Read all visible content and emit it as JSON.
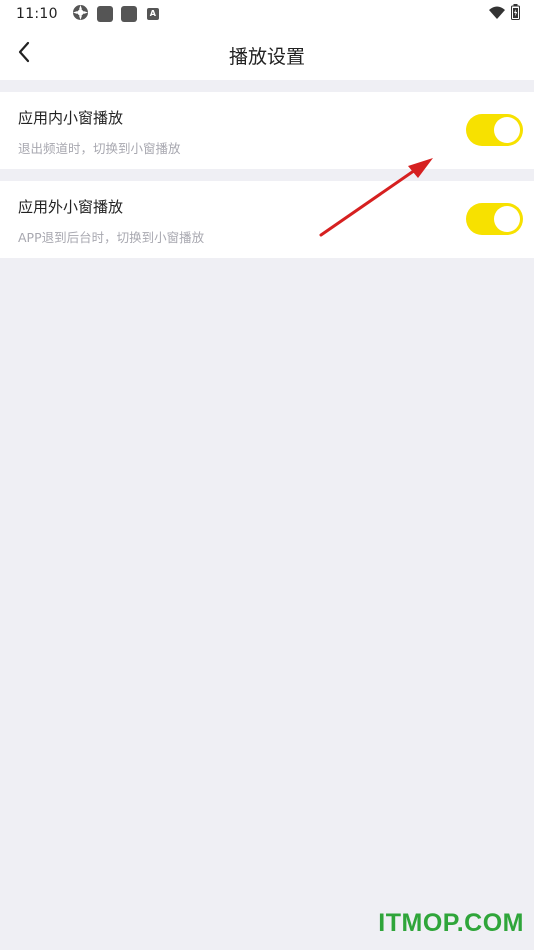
{
  "status_bar": {
    "time": "11:10",
    "icons": [
      "settings-icon",
      "app-icon",
      "app-icon",
      "a-icon",
      "wifi-icon",
      "battery-icon"
    ],
    "a_glyph": "A"
  },
  "nav": {
    "title": "播放设置",
    "back_icon": "chevron-left-icon"
  },
  "settings": [
    {
      "title": "应用内小窗播放",
      "subtitle": "退出频道时，切换到小窗播放",
      "enabled": true
    },
    {
      "title": "应用外小窗播放",
      "subtitle": "APP退到后台时，切换到小窗播放",
      "enabled": true
    }
  ],
  "colors": {
    "toggle_on": "#f7e100",
    "background": "#efeff4",
    "arrow": "#d62020",
    "watermark": "#2fa53a"
  },
  "watermark": "ITMOP.COM"
}
